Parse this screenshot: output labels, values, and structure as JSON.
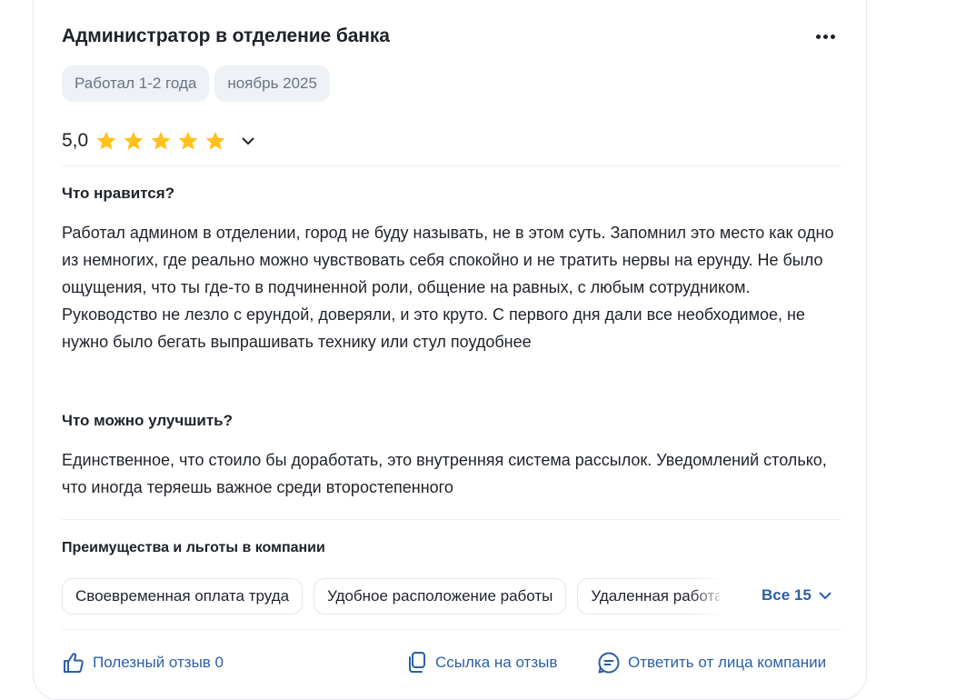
{
  "review": {
    "title": "Администратор в отделение банка",
    "tags": [
      "Работал 1-2 года",
      "ноябрь 2025"
    ],
    "rating": {
      "value": "5,0",
      "stars_filled": 5,
      "stars_total": 5,
      "star_color": "#ffc21a"
    },
    "likes_heading": "Что нравится?",
    "likes_text": "Работал админом в отделении, город не буду называть, не в этом суть. Запомнил это место как одно из немногих, где реально можно чувствовать себя спокойно и не тратить нервы на ерунду. Не было ощущения, что ты где-то в подчиненной роли, общение на равных, с любым сотрудником. Руководство не лезло с ерундой, доверяли, и это круто. С первого дня дали все необходимое, не нужно было бегать выпрашивать технику или стул поудобнее",
    "improve_heading": "Что можно улучшить?",
    "improve_text": "Единственное, что стоило бы доработать, это внутренняя система рассылок. Уведомлений столько, что иногда теряешь важное среди второстепенного"
  },
  "benefits": {
    "heading": "Преимущества и льготы в компании",
    "items": [
      "Своевременная оплата труда",
      "Удобное расположение работы",
      "Удаленная работа"
    ],
    "all_label": "Все 15"
  },
  "actions": {
    "helpful": "Полезный отзыв 0",
    "link": "Ссылка на отзыв",
    "reply": "Ответить от лица компании"
  },
  "colors": {
    "text": "#1f2329",
    "muted": "#6c7480",
    "link": "#2b5fa8",
    "chip_bg": "#eef1f6"
  },
  "icons": {
    "more": "more-dots-icon",
    "star": "star-icon",
    "chevron": "chevron-down-icon",
    "thumb": "thumb-up-icon",
    "link": "copy-link-icon",
    "reply": "reply-message-icon"
  }
}
